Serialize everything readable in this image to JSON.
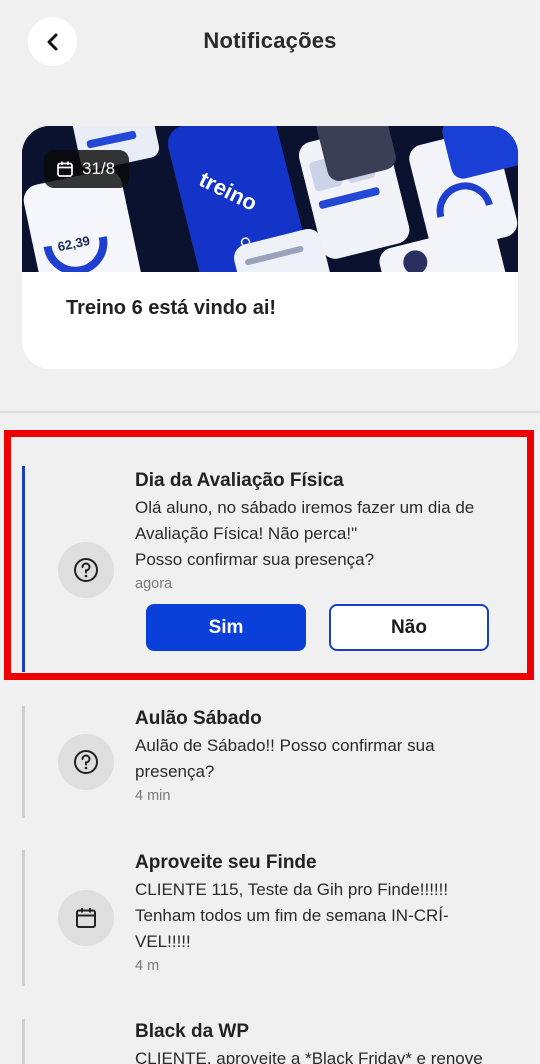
{
  "header": {
    "title": "Notificações"
  },
  "banner": {
    "date": "31/8",
    "title": "Treino 6 está vindo ai!",
    "brand_text": "treino",
    "phone_value": "62,39"
  },
  "notifications": [
    {
      "title": "Dia da Avaliação Física",
      "message_lines": [
        "Olá aluno, no sábado iremos fazer um dia de",
        "Avaliação Física! Não perca!\"",
        "Posso confirmar sua presença?"
      ],
      "time": "agora",
      "icon": "question-icon",
      "yes_label": "Sim",
      "no_label": "Não"
    },
    {
      "title": "Aulão Sábado",
      "message_lines": [
        "Aulão de Sábado!! Posso confirmar sua",
        "presença?"
      ],
      "time": "4 min",
      "icon": "question-icon"
    },
    {
      "title": "Aproveite seu Finde",
      "message_lines": [
        "CLIENTE 115, Teste da Gih pro Finde!!!!!!",
        "Tenham todos um fim de semana IN-CRÍ-",
        "VEL!!!!!"
      ],
      "time": "4 m",
      "icon": "calendar-icon"
    },
    {
      "title": "Black da WP",
      "message_lines": [
        "CLIENTE, aproveite a *Black Friday* e renove"
      ],
      "time": "",
      "icon": "question-icon"
    }
  ],
  "colors": {
    "accent": "#0a3fd9",
    "highlight": "#ee0000",
    "background": "#f0f0f0"
  }
}
